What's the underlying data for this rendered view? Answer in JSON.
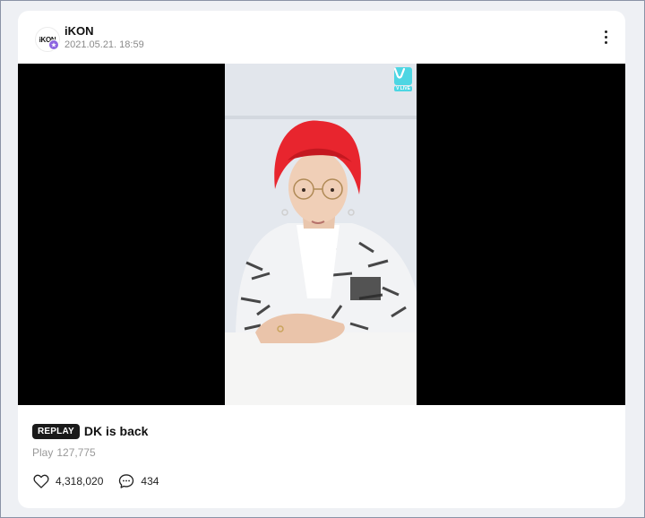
{
  "post": {
    "channel_name": "iKON",
    "avatar_text": "iKON",
    "date": "2021.05.21. 18:59",
    "badge_icon": "star-icon",
    "more_icon": "more-vertical-icon"
  },
  "video": {
    "watermark_text": "V LIVE",
    "badge": "REPLAY",
    "title": "DK is back",
    "play_label": "Play",
    "play_count": "127,775"
  },
  "actions": {
    "likes": "4,318,020",
    "comments": "434",
    "like_icon": "heart-icon",
    "comment_icon": "comment-bubble-icon"
  },
  "colors": {
    "badge_purple": "#8c64e0",
    "vlive_cyan": "#4dd6e3",
    "hair_red": "#e8252e"
  }
}
